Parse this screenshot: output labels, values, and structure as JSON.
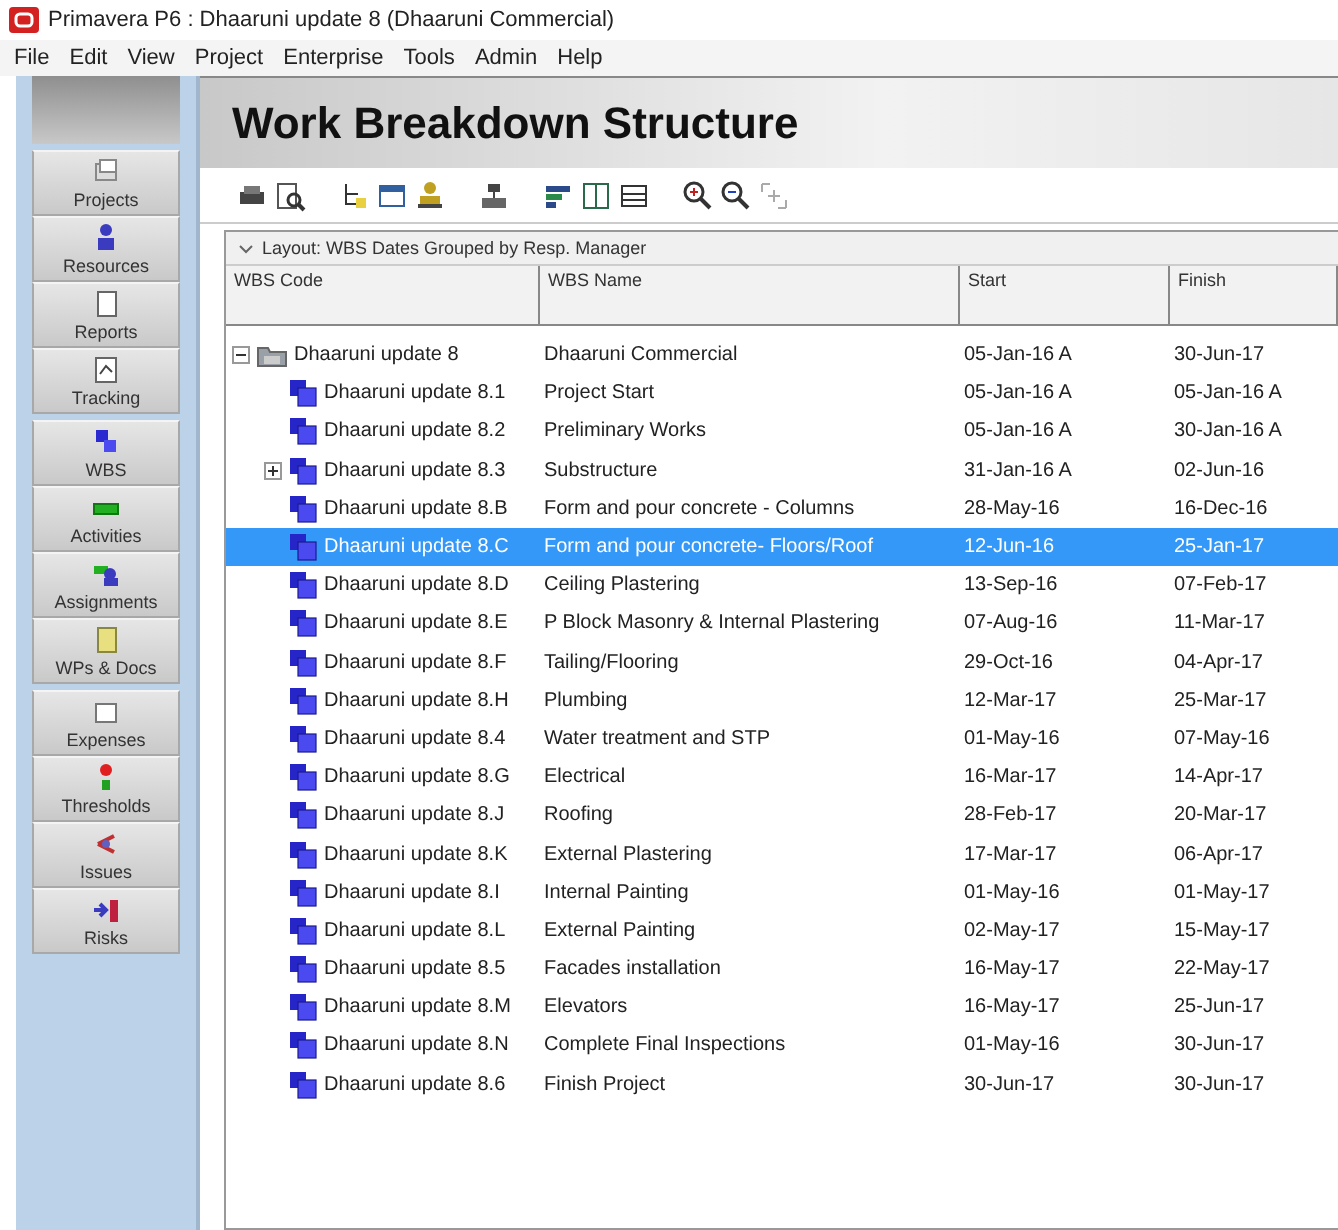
{
  "window": {
    "title": "Primavera P6 : Dhaaruni update 8 (Dhaaruni Commercial)"
  },
  "menu": [
    "File",
    "Edit",
    "View",
    "Project",
    "Enterprise",
    "Tools",
    "Admin",
    "Help"
  ],
  "sidebar": {
    "groups": [
      {
        "items": [
          "Projects",
          "Resources",
          "Reports",
          "Tracking"
        ]
      },
      {
        "items": [
          "WBS",
          "Activities",
          "Assignments",
          "WPs & Docs"
        ]
      },
      {
        "items": [
          "Expenses",
          "Thresholds",
          "Issues",
          "Risks"
        ]
      }
    ]
  },
  "page_title": "Work Breakdown Structure",
  "layout_bar": {
    "expanded": true,
    "label": "Layout: WBS Dates Grouped by Resp. Manager"
  },
  "table": {
    "columns": [
      "WBS Code",
      "WBS Name",
      "Start",
      "Finish"
    ],
    "rows": [
      {
        "code": "Dhaaruni update 8",
        "name": "Dhaaruni Commercial",
        "start": "05-Jan-16 A",
        "finish": "30-Jun-17",
        "selected": false,
        "expanded": true,
        "children": [
          {
            "code": "Dhaaruni update 8.1",
            "name": "Project Start",
            "start": "05-Jan-16 A",
            "finish": "05-Jan-16 A",
            "selected": false
          },
          {
            "code": "Dhaaruni update 8.2",
            "name": "Preliminary Works",
            "start": "05-Jan-16 A",
            "finish": "30-Jan-16 A",
            "selected": false
          },
          {
            "code": "Dhaaruni update 8.3",
            "name": "Substructure",
            "start": "31-Jan-16 A",
            "finish": "02-Jun-16",
            "selected": false,
            "expanded": false
          },
          {
            "code": "Dhaaruni update 8.B",
            "name": "Form and pour concrete - Columns",
            "start": "28-May-16",
            "finish": "16-Dec-16",
            "selected": false
          },
          {
            "code": "Dhaaruni update 8.C",
            "name": "Form and pour concrete- Floors/Roof",
            "start": "12-Jun-16",
            "finish": "25-Jan-17",
            "selected": true
          },
          {
            "code": "Dhaaruni update 8.D",
            "name": "Ceiling Plastering",
            "start": "13-Sep-16",
            "finish": "07-Feb-17",
            "selected": false
          },
          {
            "code": "Dhaaruni update 8.E",
            "name": "P Block Masonry & Internal Plastering",
            "start": "07-Aug-16",
            "finish": "11-Mar-17",
            "selected": false
          },
          {
            "code": "Dhaaruni update 8.F",
            "name": "Tailing/Flooring",
            "start": "29-Oct-16",
            "finish": "04-Apr-17",
            "selected": false
          },
          {
            "code": "Dhaaruni update 8.H",
            "name": "Plumbing",
            "start": "12-Mar-17",
            "finish": "25-Mar-17",
            "selected": false
          },
          {
            "code": "Dhaaruni update 8.4",
            "name": "Water treatment and STP",
            "start": "01-May-16",
            "finish": "07-May-16",
            "selected": false
          },
          {
            "code": "Dhaaruni update 8.G",
            "name": "Electrical",
            "start": "16-Mar-17",
            "finish": "14-Apr-17",
            "selected": false
          },
          {
            "code": "Dhaaruni update 8.J",
            "name": "Roofing",
            "start": "28-Feb-17",
            "finish": "20-Mar-17",
            "selected": false
          },
          {
            "code": "Dhaaruni update 8.K",
            "name": "External Plastering",
            "start": "17-Mar-17",
            "finish": "06-Apr-17",
            "selected": false
          },
          {
            "code": "Dhaaruni update 8.I",
            "name": "Internal Painting",
            "start": "01-May-16",
            "finish": "01-May-17",
            "selected": false
          },
          {
            "code": "Dhaaruni update 8.L",
            "name": "External Painting",
            "start": "02-May-17",
            "finish": "15-May-17",
            "selected": false
          },
          {
            "code": "Dhaaruni update 8.5",
            "name": "Facades installation",
            "start": "16-May-17",
            "finish": "22-May-17",
            "selected": false
          },
          {
            "code": "Dhaaruni update 8.M",
            "name": "Elevators",
            "start": "16-May-17",
            "finish": "25-Jun-17",
            "selected": false
          },
          {
            "code": "Dhaaruni update 8.N",
            "name": "Complete Final Inspections",
            "start": "01-May-16",
            "finish": "30-Jun-17",
            "selected": false
          },
          {
            "code": "Dhaaruni update 8.6",
            "name": "Finish Project",
            "start": "30-Jun-17",
            "finish": "30-Jun-17",
            "selected": false
          }
        ]
      }
    ]
  }
}
